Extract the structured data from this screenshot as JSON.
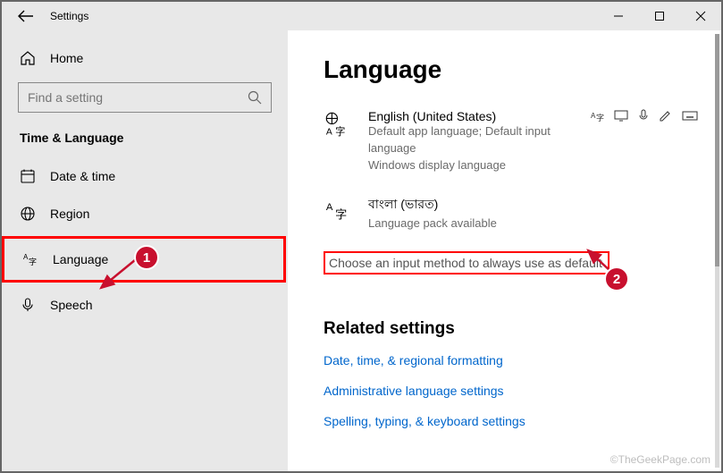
{
  "window": {
    "title": "Settings"
  },
  "sidebar": {
    "home_label": "Home",
    "search_placeholder": "Find a setting",
    "section_title": "Time & Language",
    "items": [
      {
        "label": "Date & time"
      },
      {
        "label": "Region"
      },
      {
        "label": "Language"
      },
      {
        "label": "Speech"
      }
    ]
  },
  "page": {
    "heading": "Language",
    "languages": [
      {
        "title": "English (United States)",
        "sub1": "Default app language; Default input language",
        "sub2": "Windows display language"
      },
      {
        "title": "বাংলা (ভারত)",
        "sub1": "Language pack available",
        "sub2": ""
      }
    ],
    "choose_default_link": "Choose an input method to always use as default",
    "related_heading": "Related settings",
    "related_links": [
      "Date, time, & regional formatting",
      "Administrative language settings",
      "Spelling, typing, & keyboard settings"
    ]
  },
  "markers": {
    "one": "1",
    "two": "2"
  },
  "watermark": "©TheGeekPage.com"
}
